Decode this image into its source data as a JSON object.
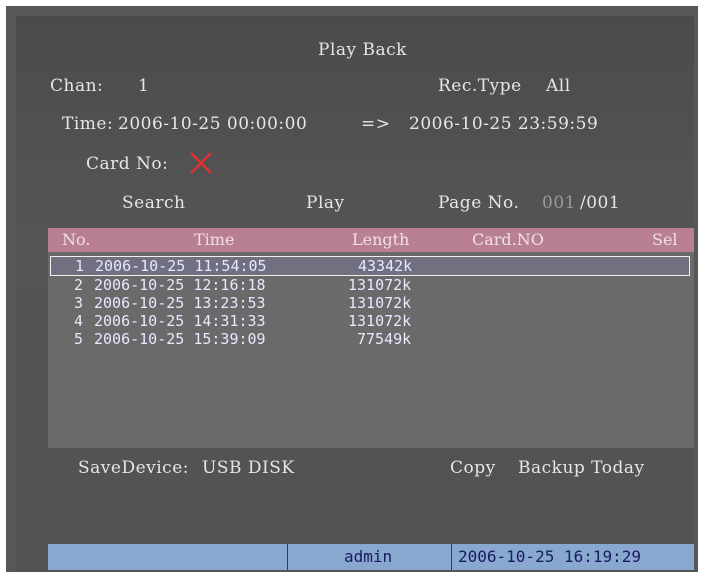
{
  "header": {
    "title": "Play Back"
  },
  "filters": {
    "chan_label": "Chan:",
    "chan_value": "1",
    "rec_type_label": "Rec.Type",
    "rec_type_value": "All",
    "time_label": "Time:",
    "time_start": "2006-10-25  00:00:00",
    "time_arrow": "=>",
    "time_end": "2006-10-25  23:59:59",
    "card_no_label": "Card No:",
    "card_no_icon": "x-mark-icon"
  },
  "actions": {
    "search_label": "Search",
    "play_label": "Play",
    "page_no_label": "Page No.",
    "page_current": "001",
    "page_total": "/001"
  },
  "table": {
    "columns": [
      "No.",
      "Time",
      "Length",
      "Card.NO",
      "Sel"
    ],
    "rows": [
      {
        "no": "1",
        "time": "2006-10-25 11:54:05",
        "length": "43342k",
        "card": "",
        "sel": ""
      },
      {
        "no": "2",
        "time": "2006-10-25 12:16:18",
        "length": "131072k",
        "card": "",
        "sel": ""
      },
      {
        "no": "3",
        "time": "2006-10-25 13:23:53",
        "length": "131072k",
        "card": "",
        "sel": ""
      },
      {
        "no": "4",
        "time": "2006-10-25 14:31:33",
        "length": "131072k",
        "card": "",
        "sel": ""
      },
      {
        "no": "5",
        "time": "2006-10-25 15:39:09",
        "length": "77549k",
        "card": "",
        "sel": ""
      }
    ]
  },
  "footer": {
    "save_device_label": "SaveDevice:",
    "save_device_value": "USB DISK",
    "copy_label": "Copy",
    "backup_today_label": "Backup Today"
  },
  "status": {
    "user": "admin",
    "datetime": "2006-10-25 16:19:29"
  },
  "colors": {
    "background": "#555555",
    "header_row": "#b88090",
    "status_bar": "#88a8d0",
    "x_mark": "#e03030"
  }
}
